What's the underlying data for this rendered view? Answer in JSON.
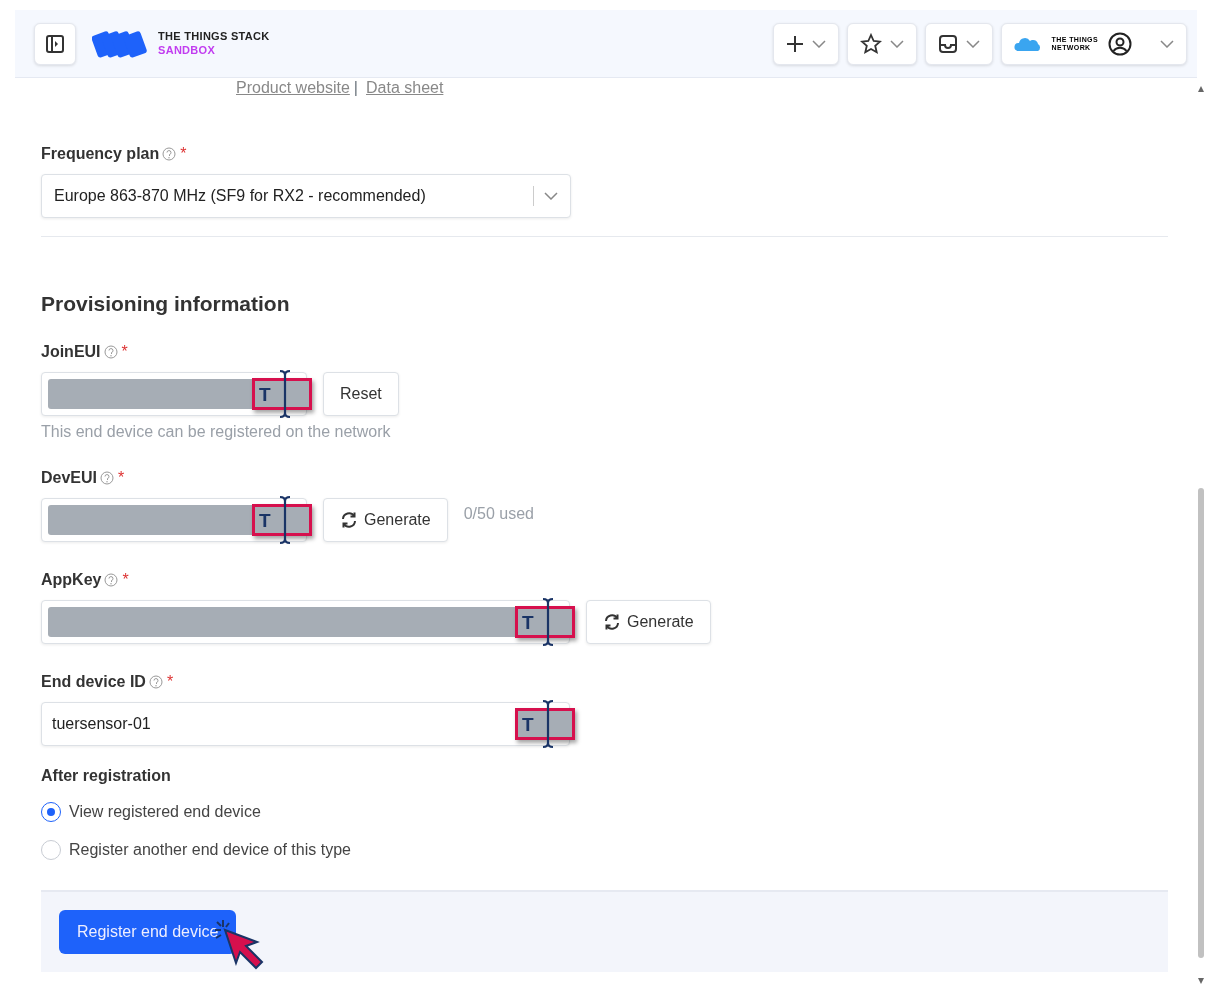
{
  "header": {
    "brand_line1": "THE THINGS STACK",
    "brand_line2": "SANDBOX",
    "network_line1": "THE THINGS",
    "network_line2": "NETWORK"
  },
  "links": {
    "items": [
      "Product website",
      "Data sheet"
    ],
    "separator": "|"
  },
  "frequency_plan": {
    "label": "Frequency plan",
    "required_mark": "*",
    "value": "Europe 863-870 MHz (SF9 for RX2 - recommended)"
  },
  "section_title": "Provisioning information",
  "fields": [
    {
      "label": "JoinEUI",
      "required_mark": "*",
      "kind": "redacted",
      "wide": false,
      "marker": "T",
      "button": {
        "label": "Reset",
        "kind": "plain"
      },
      "hint": "This end device can be registered on the network"
    },
    {
      "label": "DevEUI",
      "required_mark": "*",
      "kind": "redacted",
      "wide": false,
      "marker": "T",
      "button": {
        "label": "Generate",
        "kind": "refresh"
      },
      "note": "0/50 used"
    },
    {
      "label": "AppKey",
      "required_mark": "*",
      "kind": "redacted",
      "wide": true,
      "marker": "T",
      "button": {
        "label": "Generate",
        "kind": "refresh"
      }
    },
    {
      "label": "End device ID",
      "required_mark": "*",
      "kind": "text",
      "wide": true,
      "marker": "T",
      "value": "tuersensor-01"
    }
  ],
  "after_registration": {
    "label": "After registration",
    "options": [
      {
        "label": "View registered end device",
        "selected": true
      },
      {
        "label": "Register another end device of this type",
        "selected": false
      }
    ]
  },
  "submit": {
    "label": "Register end device"
  }
}
